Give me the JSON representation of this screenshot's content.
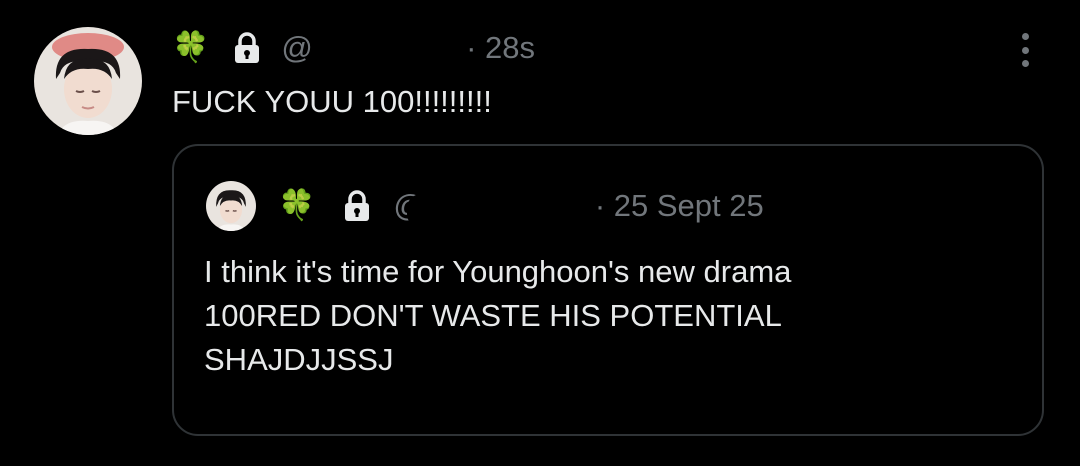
{
  "post": {
    "avatar": "avatar-photo",
    "clover_emoji": "🍀",
    "lock_icon": "lock-icon",
    "handle": "@a",
    "timestamp": "· 28s",
    "text": "FUCK YOUU 100!!!!!!!!!",
    "more_icon": "more-vertical-icon"
  },
  "quoted_post": {
    "avatar": "avatar-photo",
    "clover_emoji": "🍀",
    "lock_icon": "lock-icon",
    "handle": "@",
    "timestamp": "· 25 Sept 25",
    "text_lines": [
      "I think it's time for Younghoon's new drama",
      "100RED DON'T WASTE HIS POTENTIAL",
      "SHAJDJJSSJ"
    ]
  },
  "colors": {
    "background": "#000000",
    "text": "#e7e9ea",
    "secondary_text": "#71767b",
    "border": "#2f3336"
  }
}
